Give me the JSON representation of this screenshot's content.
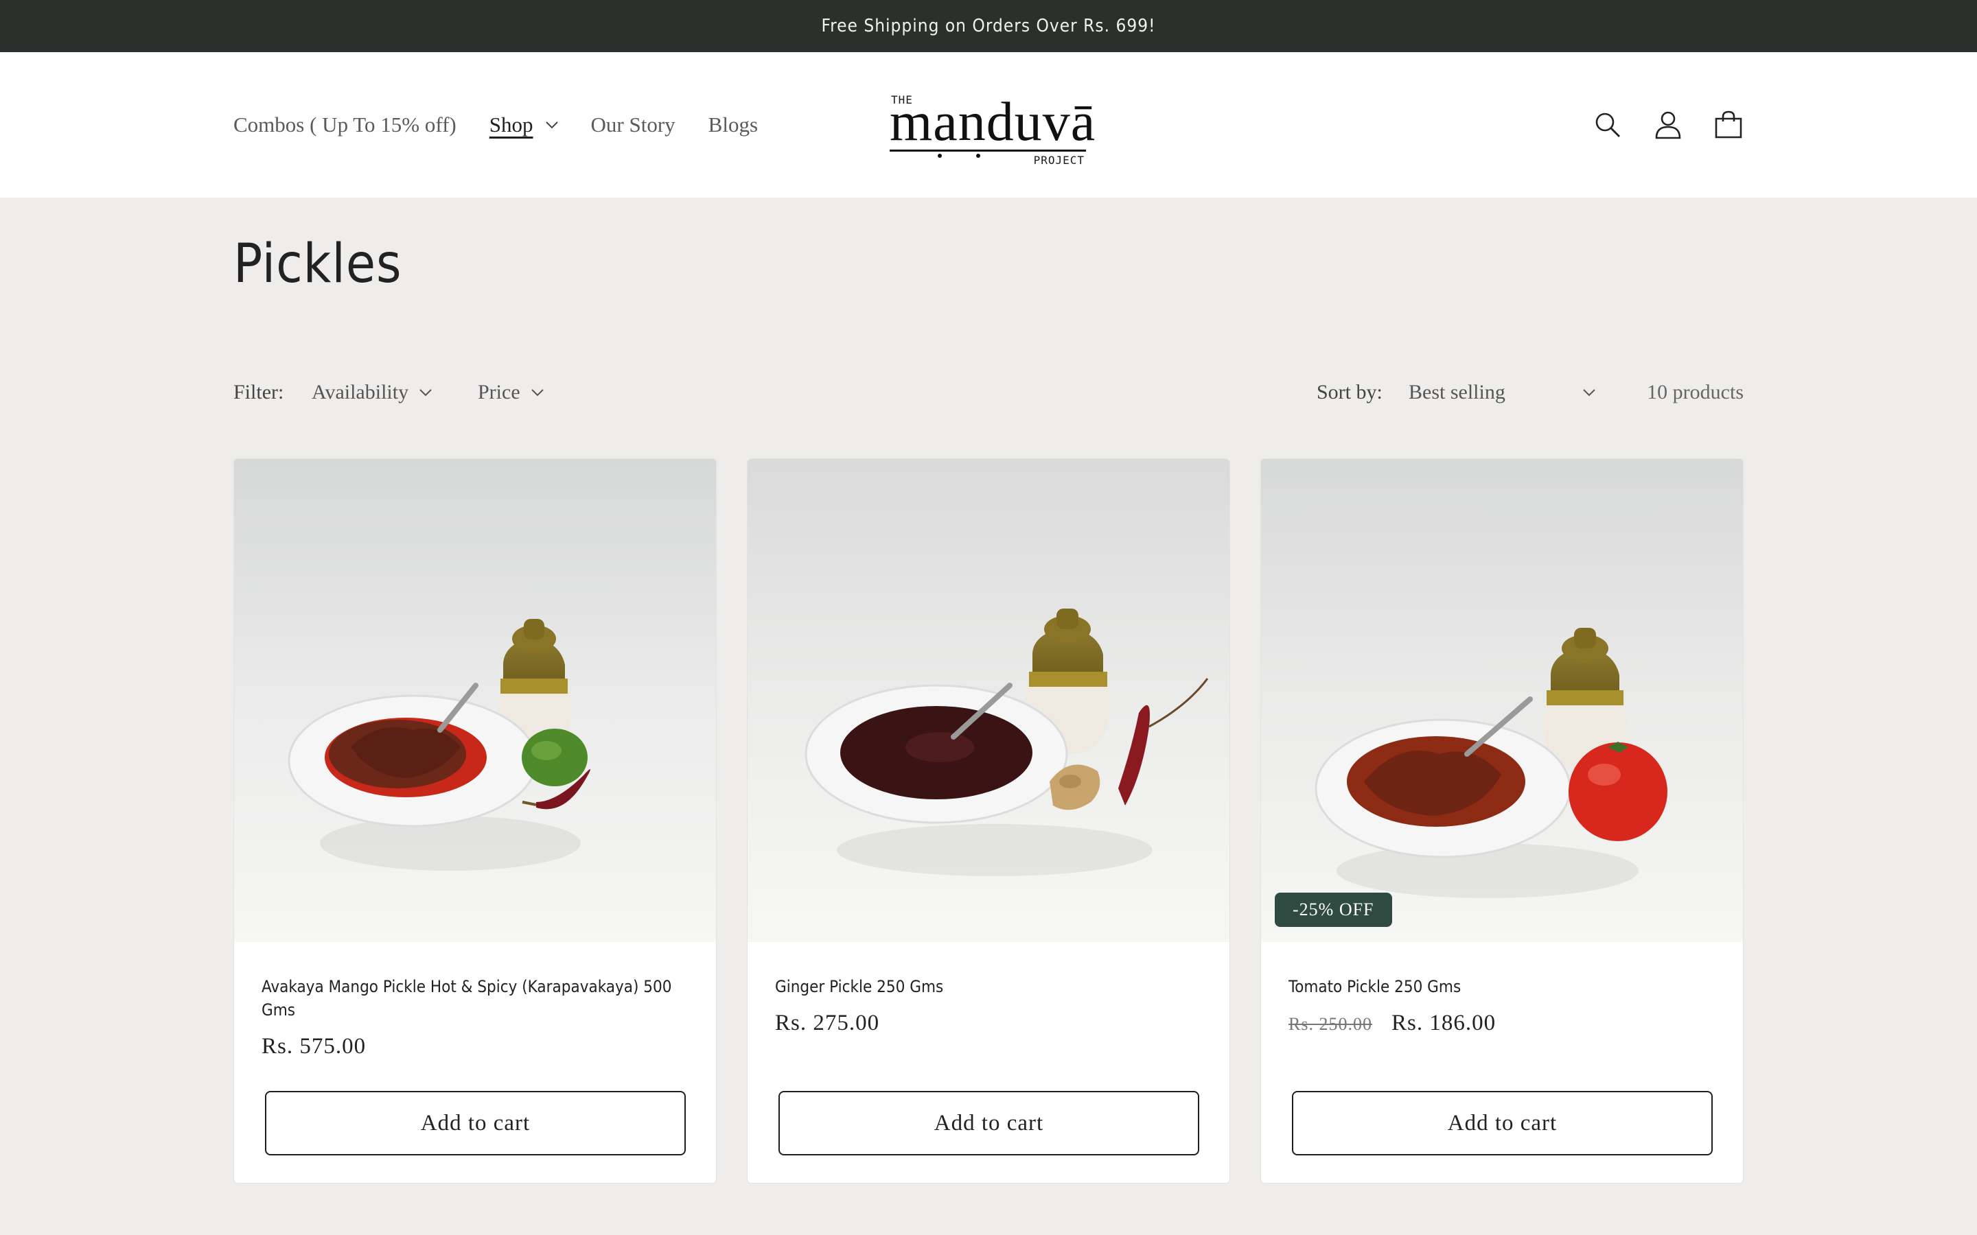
{
  "announcement": "Free Shipping on Orders Over Rs. 699!",
  "nav": {
    "items": [
      {
        "label": "Combos ( Up To 15% off)"
      },
      {
        "label": "Shop"
      },
      {
        "label": "Our Story"
      },
      {
        "label": "Blogs"
      }
    ]
  },
  "logo": {
    "top": "THE",
    "word": "manduvā",
    "bottom": "PROJECT"
  },
  "header_icons": [
    "search-icon",
    "account-icon",
    "cart-icon"
  ],
  "page": {
    "title": "Pickles"
  },
  "filters": {
    "label": "Filter:",
    "availability": "Availability",
    "price": "Price",
    "sort_label": "Sort by:",
    "sort_value": "Best selling",
    "count": "10 products"
  },
  "products": [
    {
      "name": "Avakaya Mango Pickle Hot & Spicy (Karapavakaya) 500 Gms",
      "price": "Rs. 575.00",
      "button": "Add to cart"
    },
    {
      "name": "Ginger Pickle 250 Gms",
      "price": "Rs. 275.00",
      "button": "Add to cart"
    },
    {
      "name": "Tomato Pickle 250 Gms",
      "old_price": "Rs. 250.00",
      "price": "Rs. 186.00",
      "badge": "-25% OFF",
      "button": "Add to cart"
    }
  ],
  "colors": {
    "announcement_bg": "#2b302d",
    "badge_bg": "#2f4a40",
    "page_bg": "#eeedeb"
  }
}
